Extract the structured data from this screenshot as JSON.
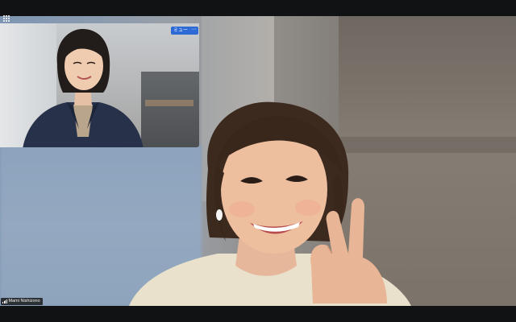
{
  "toolbar": {
    "gallery_icon": "grid-icon"
  },
  "self_view": {
    "mute_label": "ミュート",
    "more_label": "···"
  },
  "main_video": {
    "participant_name": "Mami Nishizono",
    "signal_icon": "signal-bars-icon"
  }
}
